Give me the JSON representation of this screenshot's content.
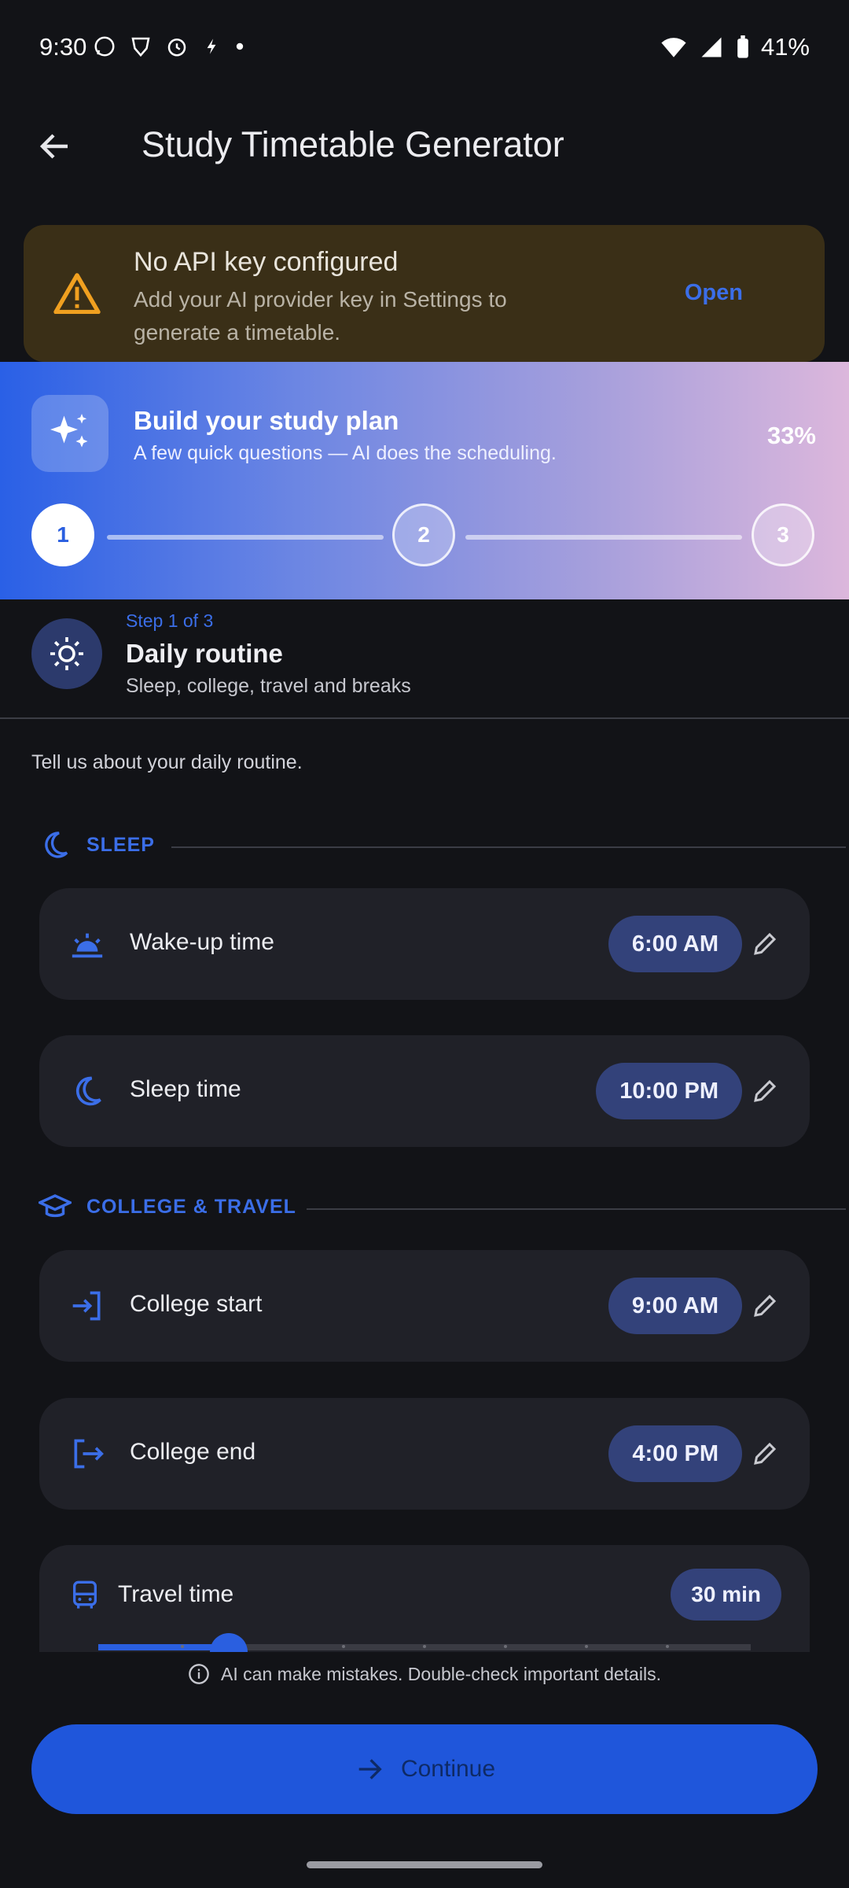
{
  "status_bar": {
    "time": "9:30",
    "battery": "41%"
  },
  "app_bar": {
    "title": "Study Timetable Generator"
  },
  "banner": {
    "title": "No API key configured",
    "message": "Add your AI provider key in Settings to generate a timetable.",
    "action": "Open"
  },
  "hero": {
    "title": "Build your study plan",
    "subtitle": "A few quick questions — AI does the scheduling.",
    "progress": "33%",
    "steps": [
      "1",
      "2",
      "3"
    ]
  },
  "step": {
    "kicker": "Step 1 of 3",
    "title": "Daily routine",
    "subtitle": "Sleep, college, travel and breaks"
  },
  "intro": "Tell us about your daily routine.",
  "sections": {
    "sleep": "SLEEP",
    "college": "COLLEGE & TRAVEL"
  },
  "rows": {
    "wake": {
      "label": "Wake-up time",
      "value": "6:00 AM"
    },
    "sleep": {
      "label": "Sleep time",
      "value": "10:00 PM"
    },
    "college_start": {
      "label": "College start",
      "value": "9:00 AM"
    },
    "college_end": {
      "label": "College end",
      "value": "4:00 PM"
    }
  },
  "travel": {
    "label": "Travel time",
    "value": "30 min",
    "slider_fraction": 0.2
  },
  "disclaimer": "AI can make mistakes. Double-check important details.",
  "continue_label": "Continue",
  "colors": {
    "accent": "#2a5fe0",
    "banner_bg": "#3a2f17",
    "warning": "#f0a020"
  }
}
